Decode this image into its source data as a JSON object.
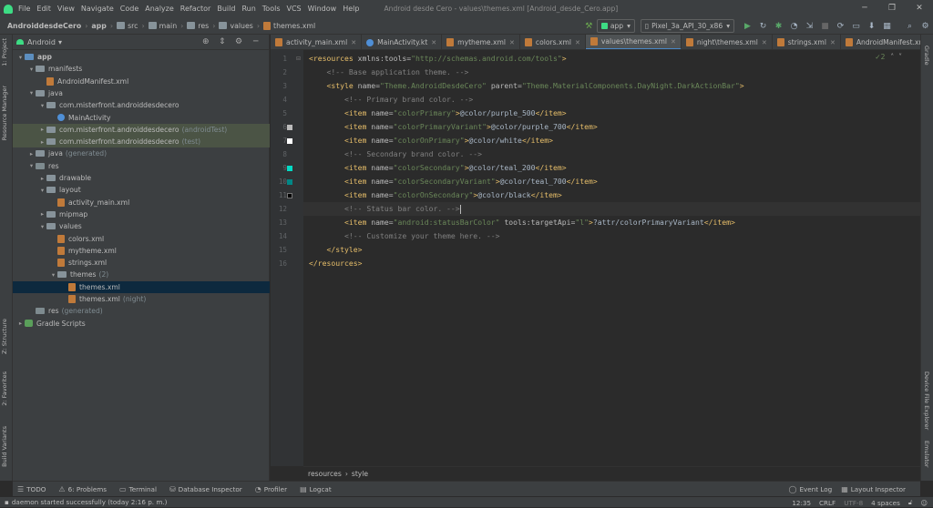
{
  "menu": [
    "File",
    "Edit",
    "View",
    "Navigate",
    "Code",
    "Analyze",
    "Refactor",
    "Build",
    "Run",
    "Tools",
    "VCS",
    "Window",
    "Help"
  ],
  "window_title": "Android desde Cero - values\\themes.xml [Android_desde_Cero.app]",
  "breadcrumbs": [
    "AndroiddesdeCero",
    "app",
    "src",
    "main",
    "res",
    "values",
    "themes.xml"
  ],
  "run_config": "app",
  "device": "Pixel_3a_API_30_x86",
  "project": {
    "view": "Android",
    "tree": [
      {
        "label": "app",
        "depth": 0,
        "arrow": "▾",
        "icon": "folder-blue",
        "bold": true
      },
      {
        "label": "manifests",
        "depth": 1,
        "arrow": "▾",
        "icon": "folder"
      },
      {
        "label": "AndroidManifest.xml",
        "depth": 2,
        "arrow": "",
        "icon": "xml"
      },
      {
        "label": "java",
        "depth": 1,
        "arrow": "▾",
        "icon": "folder"
      },
      {
        "label": "com.misterfront.androiddesdecero",
        "depth": 2,
        "arrow": "▾",
        "icon": "folder"
      },
      {
        "label": "MainActivity",
        "depth": 3,
        "arrow": "",
        "icon": "kotlin"
      },
      {
        "label": "com.misterfront.androiddesdecero",
        "suffix": "(androidTest)",
        "depth": 2,
        "arrow": "▸",
        "icon": "folder",
        "hl": true
      },
      {
        "label": "com.misterfront.androiddesdecero",
        "suffix": "(test)",
        "depth": 2,
        "arrow": "▸",
        "icon": "folder",
        "hl": true
      },
      {
        "label": "java",
        "suffix": "(generated)",
        "depth": 1,
        "arrow": "▸",
        "icon": "folder"
      },
      {
        "label": "res",
        "depth": 1,
        "arrow": "▾",
        "icon": "folder-res"
      },
      {
        "label": "drawable",
        "depth": 2,
        "arrow": "▸",
        "icon": "folder"
      },
      {
        "label": "layout",
        "depth": 2,
        "arrow": "▾",
        "icon": "folder"
      },
      {
        "label": "activity_main.xml",
        "depth": 3,
        "arrow": "",
        "icon": "xml"
      },
      {
        "label": "mipmap",
        "depth": 2,
        "arrow": "▸",
        "icon": "folder"
      },
      {
        "label": "values",
        "depth": 2,
        "arrow": "▾",
        "icon": "folder"
      },
      {
        "label": "colors.xml",
        "depth": 3,
        "arrow": "",
        "icon": "xml"
      },
      {
        "label": "mytheme.xml",
        "depth": 3,
        "arrow": "",
        "icon": "xml"
      },
      {
        "label": "strings.xml",
        "depth": 3,
        "arrow": "",
        "icon": "xml"
      },
      {
        "label": "themes",
        "suffix": "(2)",
        "depth": 3,
        "arrow": "▾",
        "icon": "folder"
      },
      {
        "label": "themes.xml",
        "depth": 4,
        "arrow": "",
        "icon": "xml",
        "sel": true
      },
      {
        "label": "themes.xml",
        "suffix": "(night)",
        "depth": 4,
        "arrow": "",
        "icon": "xml"
      },
      {
        "label": "res",
        "suffix": "(generated)",
        "depth": 1,
        "arrow": "",
        "icon": "folder-res"
      },
      {
        "label": "Gradle Scripts",
        "depth": 0,
        "arrow": "▸",
        "icon": "gradle"
      }
    ]
  },
  "tabs": [
    {
      "label": "activity_main.xml",
      "icon": "xml"
    },
    {
      "label": "MainActivity.kt",
      "icon": "kotlin"
    },
    {
      "label": "mytheme.xml",
      "icon": "xml"
    },
    {
      "label": "colors.xml",
      "icon": "xml"
    },
    {
      "label": "values\\themes.xml",
      "icon": "xml",
      "active": true
    },
    {
      "label": "night\\themes.xml",
      "icon": "xml"
    },
    {
      "label": "strings.xml",
      "icon": "xml"
    },
    {
      "label": "AndroidManifest.xn",
      "icon": "xml",
      "noclose": true
    }
  ],
  "inspection": "✓2",
  "swatches": [
    {
      "line": 6,
      "color": "#bbbbbb"
    },
    {
      "line": 7,
      "color": "#ffffff"
    },
    {
      "line": 9,
      "color": "#03dac5"
    },
    {
      "line": 10,
      "color": "#018786"
    },
    {
      "line": 11,
      "color": "#000000"
    }
  ],
  "code_lines": [
    [
      [
        "tag",
        "<resources "
      ],
      [
        "att",
        "xmlns:tools="
      ],
      [
        "str",
        "\"http://schemas.android.com/tools\""
      ],
      [
        "tag",
        ">"
      ]
    ],
    [
      [
        "com",
        "    <!-- Base application theme. -->"
      ]
    ],
    [
      [
        "tag",
        "    <style "
      ],
      [
        "att",
        "name="
      ],
      [
        "str",
        "\"Theme.AndroidDesdeCero\" "
      ],
      [
        "att",
        "parent="
      ],
      [
        "str",
        "\"Theme.MaterialComponents.DayNight.DarkActionBar\""
      ],
      [
        "tag",
        ">"
      ]
    ],
    [
      [
        "com",
        "        <!-- Primary brand color. -->"
      ]
    ],
    [
      [
        "tag",
        "        <item "
      ],
      [
        "att",
        "name="
      ],
      [
        "str",
        "\"colorPrimary\""
      ],
      [
        "tag",
        ">"
      ],
      [
        "val",
        "@color/purple_500"
      ],
      [
        "tag",
        "</item>"
      ]
    ],
    [
      [
        "tag",
        "        <item "
      ],
      [
        "att",
        "name="
      ],
      [
        "str",
        "\"colorPrimaryVariant\""
      ],
      [
        "tag",
        ">"
      ],
      [
        "val",
        "@color/purple_700"
      ],
      [
        "tag",
        "</item>"
      ]
    ],
    [
      [
        "tag",
        "        <item "
      ],
      [
        "att",
        "name="
      ],
      [
        "str",
        "\"colorOnPrimary\""
      ],
      [
        "tag",
        ">"
      ],
      [
        "val",
        "@color/white"
      ],
      [
        "tag",
        "</item>"
      ]
    ],
    [
      [
        "com",
        "        <!-- Secondary brand color. -->"
      ]
    ],
    [
      [
        "tag",
        "        <item "
      ],
      [
        "att",
        "name="
      ],
      [
        "str",
        "\"colorSecondary\""
      ],
      [
        "tag",
        ">"
      ],
      [
        "val",
        "@color/teal_200"
      ],
      [
        "tag",
        "</item>"
      ]
    ],
    [
      [
        "tag",
        "        <item "
      ],
      [
        "att",
        "name="
      ],
      [
        "str",
        "\"colorSecondaryVariant\""
      ],
      [
        "tag",
        ">"
      ],
      [
        "val",
        "@color/teal_700"
      ],
      [
        "tag",
        "</item>"
      ]
    ],
    [
      [
        "tag",
        "        <item "
      ],
      [
        "att",
        "name="
      ],
      [
        "str",
        "\"colorOnSecondary\""
      ],
      [
        "tag",
        ">"
      ],
      [
        "val",
        "@color/black"
      ],
      [
        "tag",
        "</item>"
      ]
    ],
    [
      [
        "com",
        "        <!-- Status bar color. -->"
      ]
    ],
    [
      [
        "tag",
        "        <item "
      ],
      [
        "att",
        "name="
      ],
      [
        "str",
        "\"android:statusBarColor\" "
      ],
      [
        "att",
        "tools:targetApi="
      ],
      [
        "str",
        "\"l\""
      ],
      [
        "tag",
        ">"
      ],
      [
        "val",
        "?attr/colorPrimaryVariant"
      ],
      [
        "tag",
        "</item>"
      ]
    ],
    [
      [
        "com",
        "        <!-- Customize your theme here. -->"
      ]
    ],
    [
      [
        "tag",
        "    </style>"
      ]
    ],
    [
      [
        "tag",
        "</resources>"
      ]
    ]
  ],
  "current_line": 12,
  "editor_crumbs": [
    "resources",
    "style"
  ],
  "left_tools": [
    "1: Project",
    "Resource Manager",
    "Z: Structure",
    "2: Favorites",
    "Build Variants"
  ],
  "right_tools": [
    "Gradle",
    "Device File Explorer",
    "Emulator"
  ],
  "bottom_tools": [
    "TODO",
    "6: Problems",
    "Terminal",
    "Database Inspector",
    "Profiler",
    "Logcat"
  ],
  "bottom_right": [
    "Event Log",
    "Layout Inspector"
  ],
  "status": {
    "message": "daemon started successfully (today 2:16 p. m.)",
    "time": "12:35",
    "le": "CRLF",
    "enc": "UTF-8",
    "indent": "4 spaces"
  }
}
